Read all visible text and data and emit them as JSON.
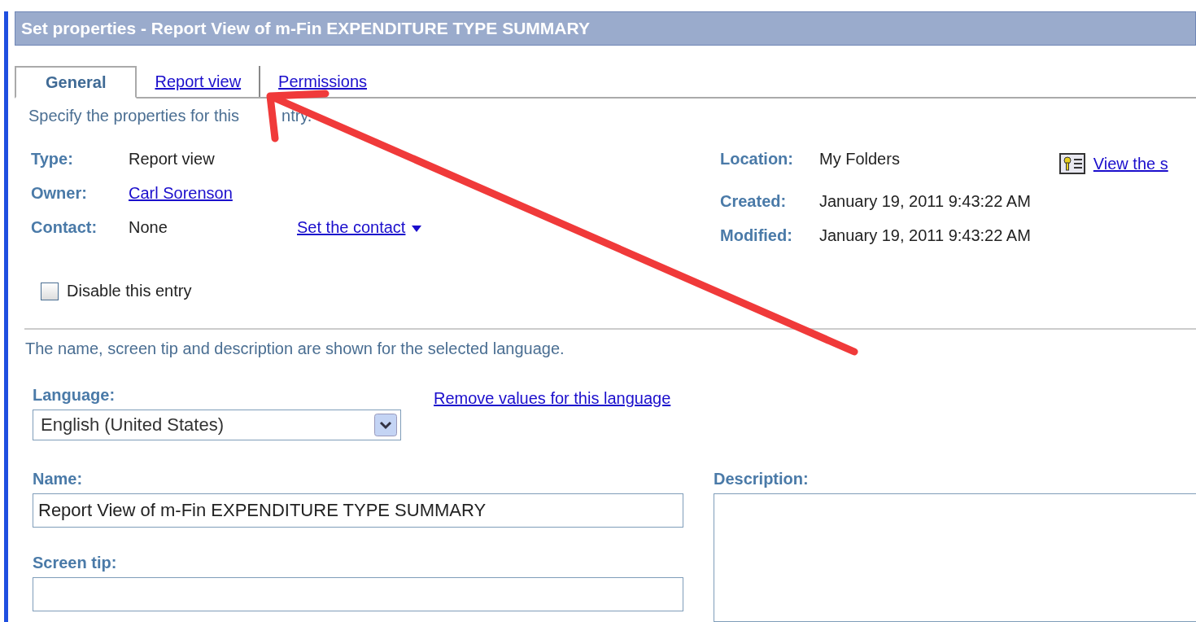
{
  "title": "Set properties - Report View of m-Fin EXPENDITURE TYPE SUMMARY",
  "tabs": [
    {
      "label": "General",
      "selected": true
    },
    {
      "label": "Report view",
      "selected": false
    },
    {
      "label": "Permissions",
      "selected": false
    }
  ],
  "intro": [
    "Specify the properties for this",
    "ntry."
  ],
  "properties_left": [
    {
      "label": "Type:",
      "value": "Report view",
      "kind": "text"
    },
    {
      "label": "Owner:",
      "value": "Carl Sorenson",
      "kind": "link"
    },
    {
      "label": "Contact:",
      "value": "None",
      "kind": "text",
      "action": "Set the contact"
    }
  ],
  "properties_right": [
    {
      "label": "Location:",
      "value": "My Folders"
    },
    {
      "label": "Created:",
      "value": "January 19, 2011 9:43:22 AM"
    },
    {
      "label": "Modified:",
      "value": "January 19, 2011 9:43:22 AM"
    }
  ],
  "view_link": "View the s",
  "disable_entry": {
    "label": "Disable this entry",
    "checked": false
  },
  "language_note": "The name, screen tip and description are shown for the selected language.",
  "language": {
    "label": "Language:",
    "value": "English (United States)"
  },
  "remove_link": "Remove values for this language",
  "name": {
    "label": "Name:",
    "value": "Report View of m-Fin EXPENDITURE TYPE SUMMARY"
  },
  "screen_tip": {
    "label": "Screen tip:"
  },
  "description": {
    "label": "Description:"
  }
}
